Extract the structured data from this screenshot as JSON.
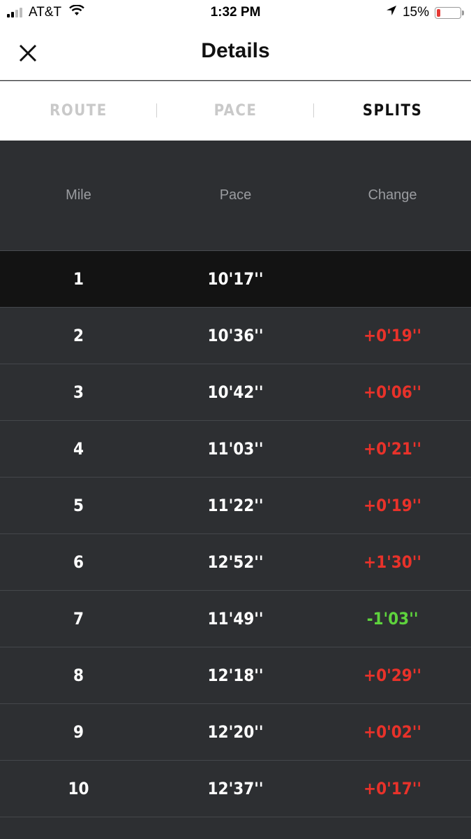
{
  "status_bar": {
    "carrier": "AT&T",
    "time": "1:32 PM",
    "battery": "15%",
    "battery_level": 0.15,
    "icons": [
      "signal-icon",
      "wifi-icon",
      "location-icon",
      "battery-icon"
    ]
  },
  "header": {
    "title": "Details",
    "close_icon": "close-icon"
  },
  "tabs": [
    {
      "label": "ROUTE",
      "active": false
    },
    {
      "label": "PACE",
      "active": false
    },
    {
      "label": "SPLITS",
      "active": true
    }
  ],
  "table": {
    "columns": [
      "Mile",
      "Pace",
      "Change"
    ],
    "rows": [
      {
        "mile": "1",
        "pace": "10'17''",
        "change": ""
      },
      {
        "mile": "2",
        "pace": "10'36''",
        "change": "+0'19''"
      },
      {
        "mile": "3",
        "pace": "10'42''",
        "change": "+0'06''"
      },
      {
        "mile": "4",
        "pace": "11'03''",
        "change": "+0'21''"
      },
      {
        "mile": "5",
        "pace": "11'22''",
        "change": "+0'19''"
      },
      {
        "mile": "6",
        "pace": "12'52''",
        "change": "+1'30''"
      },
      {
        "mile": "7",
        "pace": "11'49''",
        "change": "-1'03''"
      },
      {
        "mile": "8",
        "pace": "12'18''",
        "change": "+0'29''"
      },
      {
        "mile": "9",
        "pace": "12'20''",
        "change": "+0'02''"
      },
      {
        "mile": "10",
        "pace": "12'37''",
        "change": "+0'17''"
      }
    ]
  },
  "colors": {
    "slower": "#e8322a",
    "faster": "#5ed33d",
    "background": "#2d2f32",
    "highlight_row": "#131313"
  }
}
